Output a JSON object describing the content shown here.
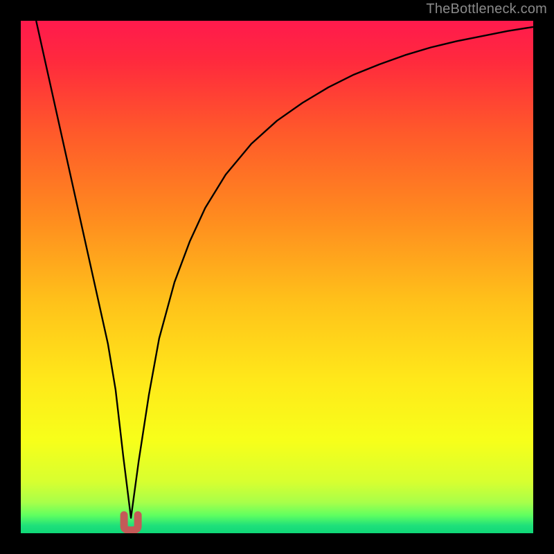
{
  "watermark": "TheBottleneck.com",
  "chart_data": {
    "type": "line",
    "title": "",
    "xlabel": "",
    "ylabel": "",
    "xlim": [
      0,
      100
    ],
    "ylim": [
      0,
      100
    ],
    "grid": false,
    "series": [
      {
        "name": "bottleneck-curve",
        "x": [
          3,
          5,
          7,
          9,
          11,
          13,
          15,
          17,
          18.5,
          20,
          21.5,
          23,
          25,
          27,
          30,
          33,
          36,
          40,
          45,
          50,
          55,
          60,
          65,
          70,
          75,
          80,
          85,
          90,
          95,
          100
        ],
        "y": [
          100,
          91,
          82,
          73,
          64,
          55,
          46,
          37,
          28,
          15,
          3,
          14,
          27,
          38,
          49,
          57,
          63.5,
          70,
          76,
          80.5,
          84,
          87,
          89.5,
          91.5,
          93.3,
          94.8,
          96,
          97,
          98,
          98.8
        ]
      }
    ],
    "annotations": [
      {
        "name": "optimal-u-mark",
        "x": 21.5,
        "y": 3
      }
    ],
    "gradient_stops": [
      {
        "offset": 0.0,
        "color": "#ff1a4d"
      },
      {
        "offset": 0.08,
        "color": "#ff2a3d"
      },
      {
        "offset": 0.22,
        "color": "#ff5a2a"
      },
      {
        "offset": 0.38,
        "color": "#ff8a1f"
      },
      {
        "offset": 0.55,
        "color": "#ffc21a"
      },
      {
        "offset": 0.7,
        "color": "#ffe81a"
      },
      {
        "offset": 0.82,
        "color": "#f7ff1a"
      },
      {
        "offset": 0.9,
        "color": "#d7ff30"
      },
      {
        "offset": 0.94,
        "color": "#a8ff4a"
      },
      {
        "offset": 0.965,
        "color": "#60ff60"
      },
      {
        "offset": 0.985,
        "color": "#1fe07a"
      },
      {
        "offset": 1.0,
        "color": "#0fd878"
      }
    ]
  }
}
